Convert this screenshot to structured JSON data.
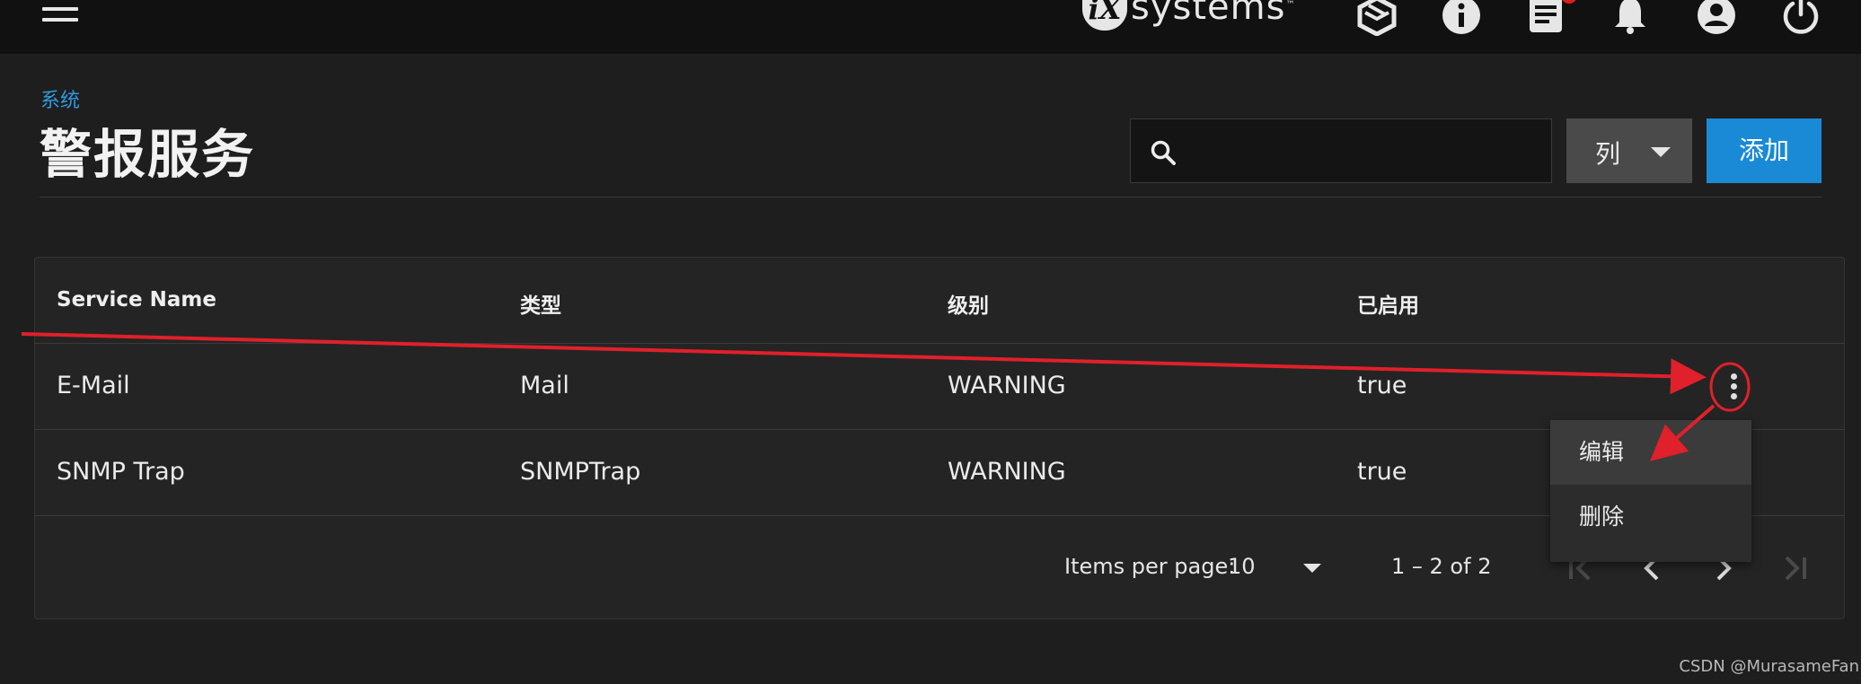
{
  "topbar": {
    "logo": {
      "badge": "iX",
      "text": "systems",
      "tm": "™"
    },
    "icons": [
      "menu-icon",
      "truecommand-icon",
      "info-icon",
      "task-list-icon",
      "bell-icon",
      "account-icon",
      "power-icon"
    ]
  },
  "header": {
    "breadcrumb": "系统",
    "title": "警报服务"
  },
  "toolbar": {
    "search_placeholder": "",
    "columns_label": "列",
    "add_label": "添加"
  },
  "table": {
    "columns": [
      "Service Name",
      "类型",
      "级别",
      "已启用"
    ],
    "rows": [
      {
        "name": "E-Mail",
        "type": "Mail",
        "level": "WARNING",
        "enabled": "true"
      },
      {
        "name": "SNMP Trap",
        "type": "SNMPTrap",
        "level": "WARNING",
        "enabled": "true"
      }
    ]
  },
  "paginator": {
    "items_per_page_label": "Items per page:",
    "items_per_page_value": "10",
    "range_label": "1 – 2 of 2"
  },
  "context_menu": {
    "items": [
      "编辑",
      "删除"
    ]
  },
  "watermark": "CSDN @MurasameFan",
  "colors": {
    "accent": "#1a8ad6",
    "breadcrumb": "#2f9ae0",
    "annotation_red": "#e0202a",
    "background": "#1e1e1e",
    "topbar": "#111111"
  }
}
